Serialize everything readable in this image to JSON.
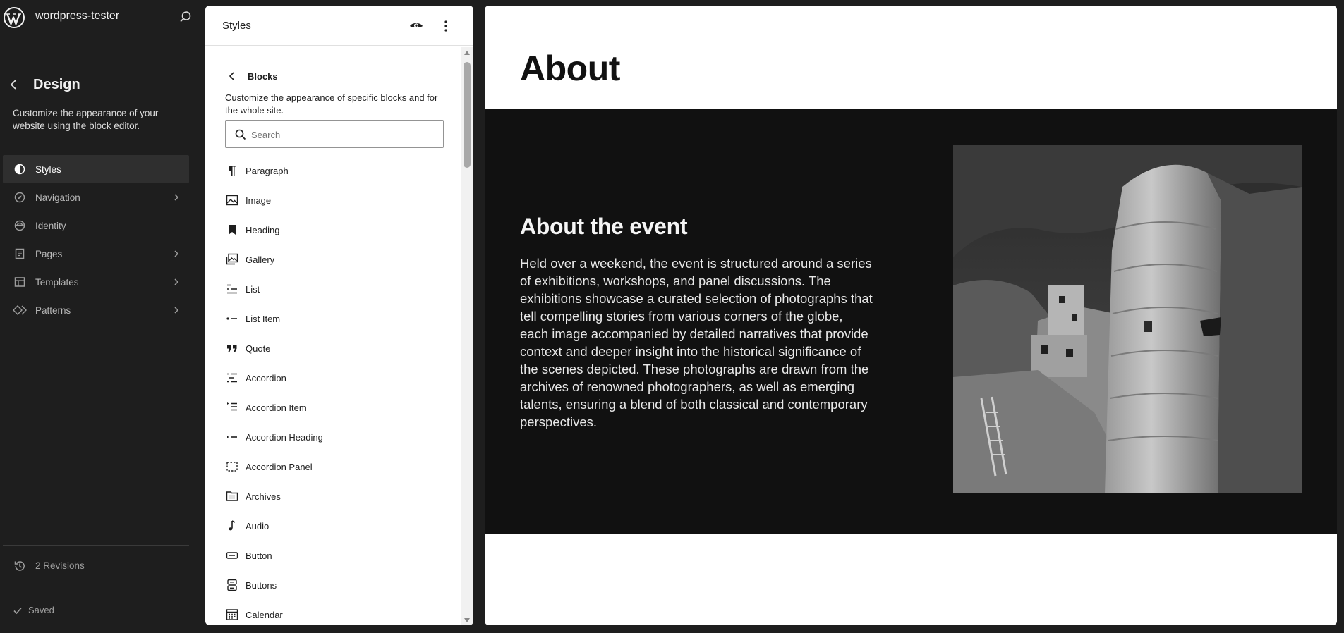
{
  "sidebar": {
    "site_name": "wordpress-tester",
    "design_title": "Design",
    "design_desc": "Customize the appearance of your website using the block editor.",
    "items": [
      {
        "label": "Styles",
        "icon": "styles-icon",
        "active": true,
        "chevron": false
      },
      {
        "label": "Navigation",
        "icon": "navigation-icon",
        "active": false,
        "chevron": true
      },
      {
        "label": "Identity",
        "icon": "identity-icon",
        "active": false,
        "chevron": false
      },
      {
        "label": "Pages",
        "icon": "pages-icon",
        "active": false,
        "chevron": true
      },
      {
        "label": "Templates",
        "icon": "templates-icon",
        "active": false,
        "chevron": true
      },
      {
        "label": "Patterns",
        "icon": "patterns-icon",
        "active": false,
        "chevron": true
      }
    ],
    "revisions": "2 Revisions",
    "saved": "Saved"
  },
  "styles_panel": {
    "title": "Styles",
    "blocks_title": "Blocks",
    "blocks_desc": "Customize the appearance of specific blocks and for the whole site.",
    "search_placeholder": "Search",
    "blocks": [
      {
        "label": "Paragraph",
        "icon": "paragraph-icon"
      },
      {
        "label": "Image",
        "icon": "image-icon"
      },
      {
        "label": "Heading",
        "icon": "heading-icon"
      },
      {
        "label": "Gallery",
        "icon": "gallery-icon"
      },
      {
        "label": "List",
        "icon": "list-icon"
      },
      {
        "label": "List Item",
        "icon": "list-item-icon"
      },
      {
        "label": "Quote",
        "icon": "quote-icon"
      },
      {
        "label": "Accordion",
        "icon": "accordion-icon"
      },
      {
        "label": "Accordion Item",
        "icon": "accordion-item-icon"
      },
      {
        "label": "Accordion Heading",
        "icon": "accordion-heading-icon"
      },
      {
        "label": "Accordion Panel",
        "icon": "accordion-panel-icon"
      },
      {
        "label": "Archives",
        "icon": "archives-icon"
      },
      {
        "label": "Audio",
        "icon": "audio-icon"
      },
      {
        "label": "Button",
        "icon": "button-icon"
      },
      {
        "label": "Buttons",
        "icon": "buttons-icon"
      },
      {
        "label": "Calendar",
        "icon": "calendar-icon"
      }
    ]
  },
  "canvas": {
    "page_title": "About",
    "event_heading": "About the event",
    "event_text": "Held over a weekend, the event is structured around a series of exhibitions, workshops, and panel discussions. The exhibitions showcase a curated selection of photographs that tell compelling stories from various corners of the globe, each image accompanied by detailed narratives that provide context and deeper insight into the historical significance of the scenes depicted. These photographs are drawn from the archives of renowned photographers, as well as emerging talents, ensuring a blend of both classical and contemporary perspectives."
  },
  "colors": {
    "sidebar_bg": "#1e1e1e",
    "active_item_bg": "#2f2f2f",
    "dark_section_bg": "#111111"
  }
}
